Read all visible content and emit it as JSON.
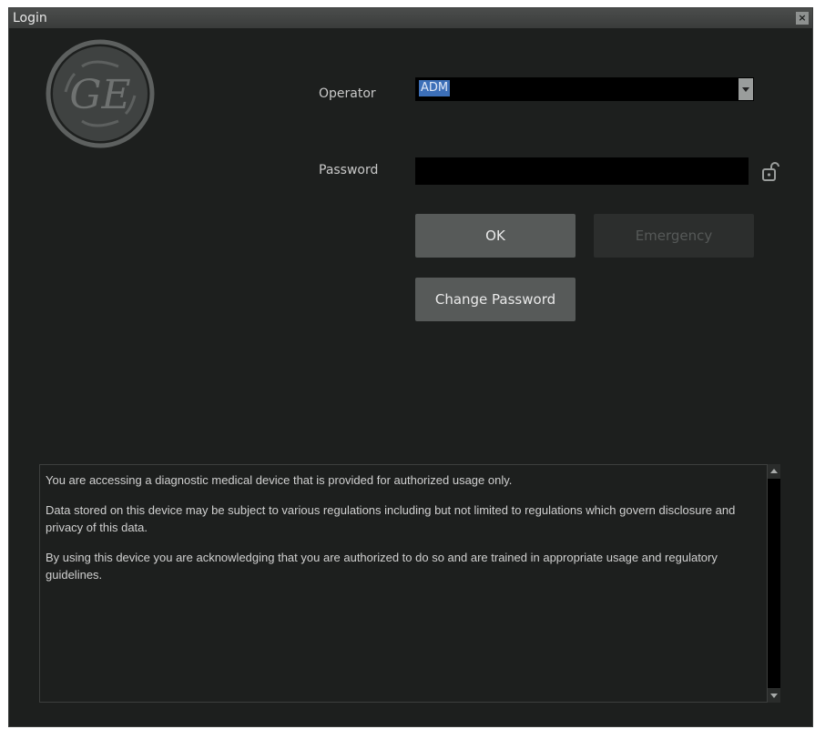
{
  "window": {
    "title": "Login",
    "close_label": "×"
  },
  "logo": {
    "text": "GE"
  },
  "operator": {
    "label": "Operator",
    "value": "ADM"
  },
  "password": {
    "label": "Password",
    "value": ""
  },
  "buttons": {
    "ok": "OK",
    "emergency": "Emergency",
    "change_password": "Change Password"
  },
  "notice": {
    "paragraphs": [
      "You are accessing a diagnostic medical device that is provided for authorized usage only.",
      "Data stored on this device may be subject to various regulations including but not limited to regulations which govern disclosure and privacy of this data.",
      "By using this device you are acknowledging that you are authorized to do so and are trained in appropriate usage and regulatory guidelines."
    ]
  },
  "icons": [
    "ge-logo-icon",
    "dropdown-arrow-icon",
    "lock-icon",
    "close-icon",
    "scroll-up-icon",
    "scroll-down-icon"
  ],
  "colors": {
    "background": "#1d1f1e",
    "selection": "#3c6fb8",
    "button": "#575a59"
  }
}
